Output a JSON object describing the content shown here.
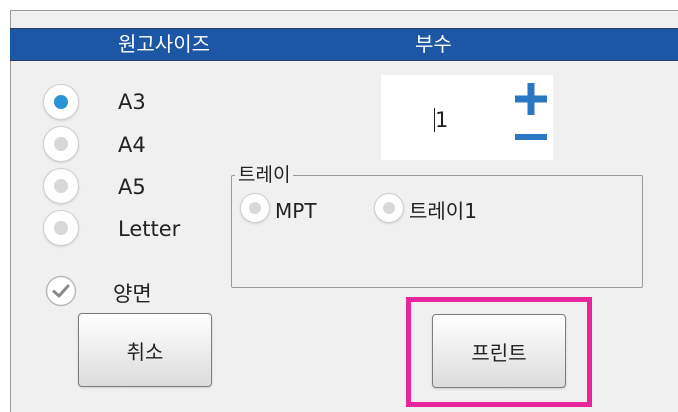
{
  "header": {
    "original_size_label": "원고사이즈",
    "copies_label": "부수"
  },
  "paper_size": {
    "selected": "A3",
    "options": [
      "A3",
      "A4",
      "A5",
      "Letter"
    ]
  },
  "duplex": {
    "label": "양면",
    "checked": false
  },
  "copies": {
    "value": "1",
    "increment_icon": "plus-icon",
    "decrement_icon": "minus-icon"
  },
  "tray": {
    "legend": "트레이",
    "options": [
      "MPT",
      "트레이1"
    ]
  },
  "buttons": {
    "cancel_label": "취소",
    "print_label": "프린트"
  },
  "colors": {
    "header_bar": "#1c57a5",
    "radio_selected": "#2a93d5",
    "stepper_icons": "#2a77c3",
    "highlight_border": "#e8259a"
  }
}
